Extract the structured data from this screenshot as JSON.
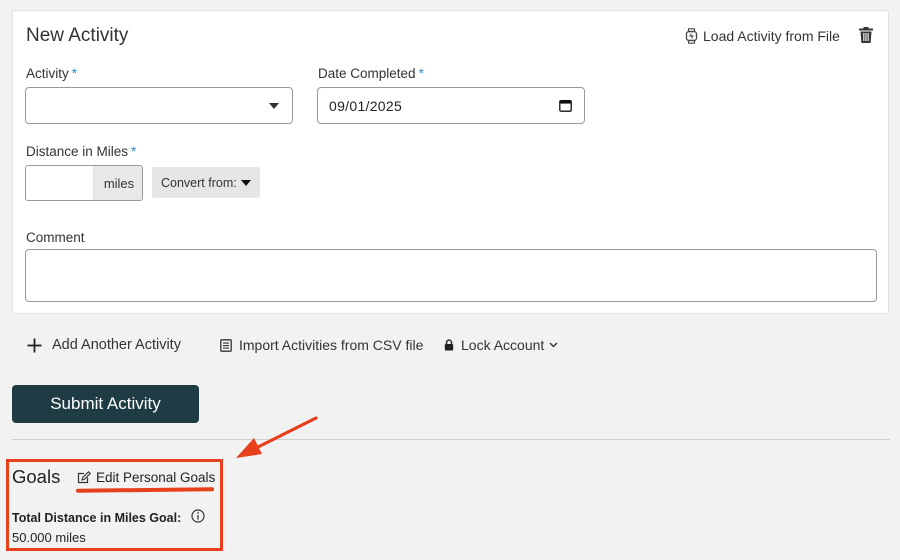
{
  "form": {
    "title": "New Activity",
    "load_file_label": "Load Activity from File",
    "activity_label": "Activity",
    "required_mark": "*",
    "activity_value": "",
    "date_label": "Date Completed",
    "date_value": "09/01/2025",
    "distance_label": "Distance in Miles",
    "distance_value": "",
    "distance_unit": "miles",
    "convert_label": "Convert from:",
    "comment_label": "Comment",
    "comment_value": ""
  },
  "actions": {
    "add_another": "Add Another Activity",
    "import_csv": "Import Activities from CSV file",
    "lock_account": "Lock Account",
    "submit": "Submit Activity"
  },
  "goals": {
    "title": "Goals",
    "edit_label": "Edit Personal Goals",
    "distance_goal_label": "Total Distance in Miles Goal:",
    "distance_goal_value": "50.000 miles"
  },
  "colors": {
    "accent_required": "#2a8fc7",
    "submit_bg": "#1f3b44",
    "annotation_red": "#e8401c"
  },
  "icons": {
    "load_file": "watch-icon",
    "delete": "trash-icon",
    "calendar": "calendar-icon",
    "add": "plus-icon",
    "import": "document-list-icon",
    "lock": "lock-icon",
    "lock_dropdown": "chevron-down-icon",
    "edit": "edit-pencil-icon",
    "info": "info-icon"
  }
}
